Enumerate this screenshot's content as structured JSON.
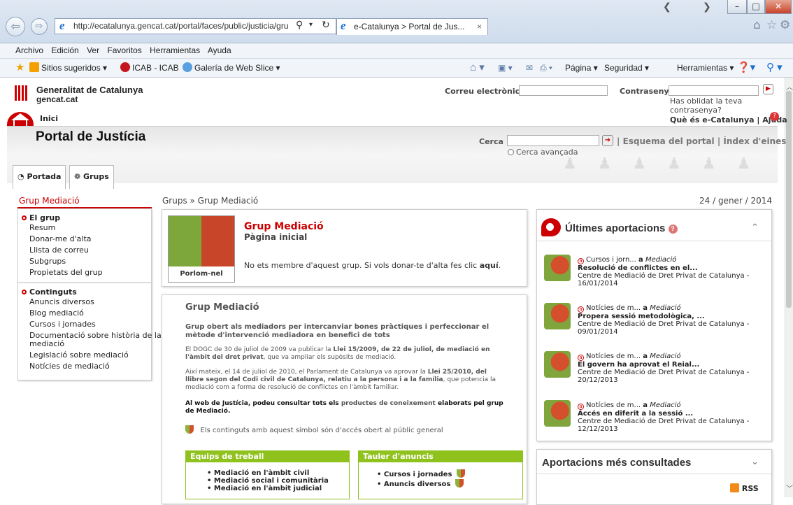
{
  "browser": {
    "url": "http://ecatalunya.gencat.cat/portal/faces/public/justicia/gru",
    "tab_title": "e-Catalunya > Portal de Jus...",
    "tab_close": "×",
    "menu": [
      "Archivo",
      "Edición",
      "Ver",
      "Favoritos",
      "Herramientas",
      "Ayuda"
    ],
    "favorites": {
      "sitios": "Sitios sugeridos ▾",
      "icab": "ICAB - ICAB",
      "galeria": "Galería de Web Slice ▾"
    },
    "toolbar": {
      "pagina": "Página ▾",
      "seguridad": "Seguridad ▾",
      "herramientas": "Herramientas ▾"
    }
  },
  "header": {
    "org_name": "Generalitat de Catalunya",
    "org_domain": "gencat.cat",
    "email_label": "Correu electrònic",
    "password_label": "Contrasenya",
    "forgot_password": "Has oblidat la teva contrasenya?",
    "home_label": "Inici",
    "what_is": "Què és e-Catalunya",
    "help": "Ajuda",
    "portal_title": "Portal de Justícia",
    "search_label": "Cerca",
    "portal_schema": "Esquema del portal",
    "tools_index": "Índex d'eines",
    "advanced_search": "Cerca avançada",
    "tab_portada": "Portada",
    "tab_grups": "Grups"
  },
  "breadcrumb": {
    "section": "Grup Mediació",
    "path": "Grups » Grup Mediació",
    "date": "24 / gener / 2014"
  },
  "leftmenu": {
    "group_heading": "El grup",
    "group_items": [
      "Resum",
      "Donar-me d'alta",
      "Llista de correu",
      "Subgrups",
      "Propietats del grup"
    ],
    "content_heading": "Continguts",
    "content_items": [
      "Anuncis diversos",
      "Blog mediació",
      "Cursos i jornades",
      "Documentació sobre història de la",
      "mediació",
      "Legislació sobre mediació",
      "Notícies de mediació"
    ]
  },
  "groupbox": {
    "title": "Grup Mediació",
    "subtitle": "Pàgina inicial",
    "notice": "No ets membre d'aquest grup. Si vols donar-te d'alta fes clic",
    "notice_link": "aquí",
    "image_caption": "Porlom-nel"
  },
  "content": {
    "title": "Grup Mediació",
    "lead": "Grup obert als mediadors per intercanviar bones pràctiques i perfeccionar el mètode d'intervenció mediadora en benefici de tots",
    "p1_a": "El DOGC de 30 de juliol de 2009 va publicar la",
    "p1_b": "Llei 15/2009, de 22 de juliol, de mediació en l'àmbit del dret privat",
    "p1_c": ", que va ampliar els supòsits de mediació.",
    "p2_a": "Així mateix, el 14 de juliol de 2010, el Parlament de Catalunya va aprovar la",
    "p2_b": "Llei 25/2010, del llibre segon del Codi civil de Catalunya, relatiu a la persona i a la família",
    "p2_c": ", que potencia la mediació com a forma de resolució de conflictes en l'àmbit familiar.",
    "p3_a": "Al web de Justícia, podeu consultar tots els",
    "p3_b": "productes de coneixement",
    "p3_c": "elaborats pel grup de Mediació.",
    "open_access": "Els continguts amb aquest símbol són d'accés obert al públic general",
    "teams_head": "Equips de treball",
    "teams": [
      "Mediació en l'àmbit civil",
      "Mediació social i comunitària",
      "Mediació en l'àmbit judicial"
    ],
    "board_head": "Tauler d'anuncis",
    "board": [
      "Cursos i jornades",
      "Anuncis diversos"
    ]
  },
  "latest": {
    "title": "Últimes aportacions",
    "items": [
      {
        "cat": "Cursos i jorn...",
        "a": "a",
        "group": "Mediació",
        "title": "Resolució de conflictes en el...",
        "org": "Centre de Mediació de Dret Privat de Catalunya -",
        "date": "16/01/2014"
      },
      {
        "cat": "Notícies de m...",
        "a": "a",
        "group": "Mediació",
        "title": "Propera sessió metodològica, ...",
        "org": "Centre de Mediació de Dret Privat de Catalunya -",
        "date": "09/01/2014"
      },
      {
        "cat": "Notícies de m...",
        "a": "a",
        "group": "Mediació",
        "title": "El govern ha aprovat el Reial...",
        "org": "Centre de Mediació de Dret Privat de Catalunya -",
        "date": "20/12/2013"
      },
      {
        "cat": "Notícies de m...",
        "a": "a",
        "group": "Mediació",
        "title": "Accés en diferit a la sessió ...",
        "org": "Centre de Mediació de Dret Privat de Catalunya -",
        "date": "12/12/2013"
      }
    ],
    "most_viewed": "Aportacions més consultades",
    "rss": "RSS"
  }
}
